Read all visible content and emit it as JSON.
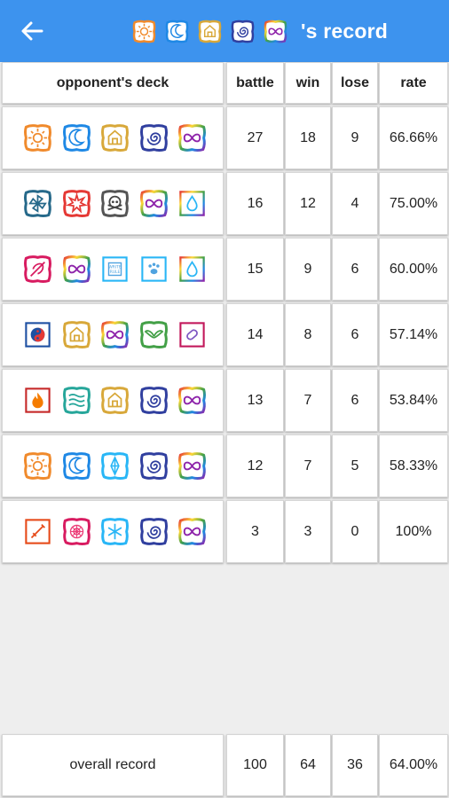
{
  "header": {
    "title_suffix": "'s record",
    "deck_icons": [
      "sun-card-icon",
      "moon-card-icon",
      "temple-card-icon",
      "spiral-card-icon",
      "infinity-card-icon"
    ]
  },
  "table": {
    "columns": [
      "opponent's deck",
      "battle",
      "win",
      "lose",
      "rate"
    ],
    "rows": [
      {
        "deck": [
          "sun-card-icon",
          "moon-card-icon",
          "temple-card-icon",
          "spiral-card-icon",
          "infinity-card-icon"
        ],
        "battle": "27",
        "win": "18",
        "lose": "9",
        "rate": "66.66%"
      },
      {
        "deck": [
          "pinwheel-card-icon",
          "starburst-card-icon",
          "skull-card-icon",
          "infinity-card-icon",
          "droplet-card-icon"
        ],
        "battle": "16",
        "win": "12",
        "lose": "4",
        "rate": "75.00%"
      },
      {
        "deck": [
          "leaf-card-icon",
          "infinity-card-icon",
          "tablet-card-icon",
          "paw-card-icon",
          "droplet-card-icon"
        ],
        "battle": "15",
        "win": "9",
        "lose": "6",
        "rate": "60.00%"
      },
      {
        "deck": [
          "yin-yang-card-icon",
          "temple-card-icon",
          "infinity-card-icon",
          "wings-card-icon",
          "pill-card-icon"
        ],
        "battle": "14",
        "win": "8",
        "lose": "6",
        "rate": "57.14%"
      },
      {
        "deck": [
          "flame-card-icon",
          "waves-card-icon",
          "temple-card-icon",
          "spiral-card-icon",
          "infinity-card-icon"
        ],
        "battle": "13",
        "win": "7",
        "lose": "6",
        "rate": "53.84%"
      },
      {
        "deck": [
          "sun-card-icon",
          "moon-card-icon",
          "crystal-card-icon",
          "spiral-card-icon",
          "infinity-card-icon"
        ],
        "battle": "12",
        "win": "7",
        "lose": "5",
        "rate": "58.33%"
      },
      {
        "deck": [
          "sword-card-icon",
          "web-card-icon",
          "snowflake-card-icon",
          "spiral-card-icon",
          "infinity-card-icon"
        ],
        "battle": "3",
        "win": "3",
        "lose": "0",
        "rate": "100%"
      }
    ],
    "overall": {
      "label": "overall record",
      "battle": "100",
      "win": "64",
      "lose": "36",
      "rate": "64.00%"
    }
  }
}
